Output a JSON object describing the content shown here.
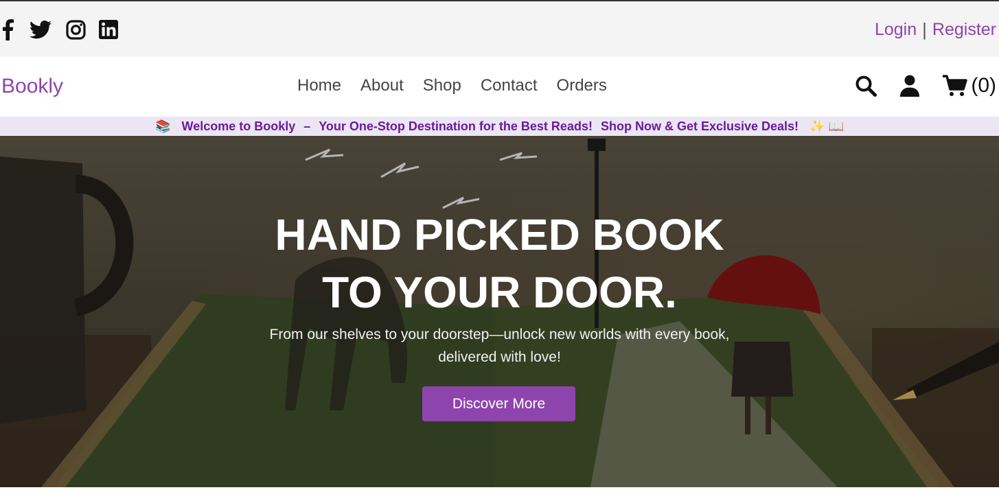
{
  "social": {
    "icons": [
      "facebook-icon",
      "twitter-icon",
      "instagram-icon",
      "linkedin-icon"
    ]
  },
  "auth": {
    "login": "Login",
    "separator": "|",
    "register": "Register"
  },
  "brand": {
    "name": "Bookly",
    "color": "#8e44ad"
  },
  "nav": {
    "items": [
      {
        "label": "Home"
      },
      {
        "label": "About"
      },
      {
        "label": "Shop"
      },
      {
        "label": "Contact"
      },
      {
        "label": "Orders"
      }
    ]
  },
  "header_tools": {
    "icons": [
      "search-icon",
      "user-icon",
      "cart-icon"
    ],
    "cart_count": "(0)"
  },
  "banner": {
    "emoji_start": "📚",
    "text1": "Welcome to Bookly",
    "dash": "–",
    "text2": "Your One-Stop Destination for the Best Reads!",
    "text3": "Shop Now & Get Exclusive Deals!",
    "emoji_end": "✨ 📖",
    "background": "#ece6f4",
    "text_color": "#6a1b9a"
  },
  "hero": {
    "title_line1": "HAND PICKED BOOK",
    "title_line2": "TO YOUR DOOR.",
    "subtitle_line1": "From our shelves to your doorstep—unlock new worlds with every book,",
    "subtitle_line2": "delivered with love!",
    "button_label": "Discover More",
    "button_color": "#8e44ad"
  }
}
